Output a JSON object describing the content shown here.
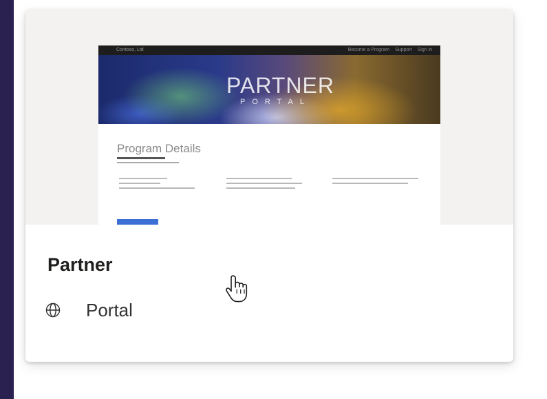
{
  "card": {
    "title": "Partner",
    "type_label": "Portal",
    "type_icon": "globe-icon"
  },
  "thumbnail": {
    "brand": "Contoso, Ltd",
    "nav_links": [
      "Become a Program",
      "Support",
      "Sign in"
    ],
    "hero_title": "PARTNER",
    "hero_subtitle": "PORTAL",
    "section_heading": "Program Details"
  },
  "colors": {
    "frame_background": "#2a2151",
    "card_background": "#ffffff",
    "thumbnail_area": "#f3f2f1",
    "thumbnail_button": "#3b6fd6"
  }
}
